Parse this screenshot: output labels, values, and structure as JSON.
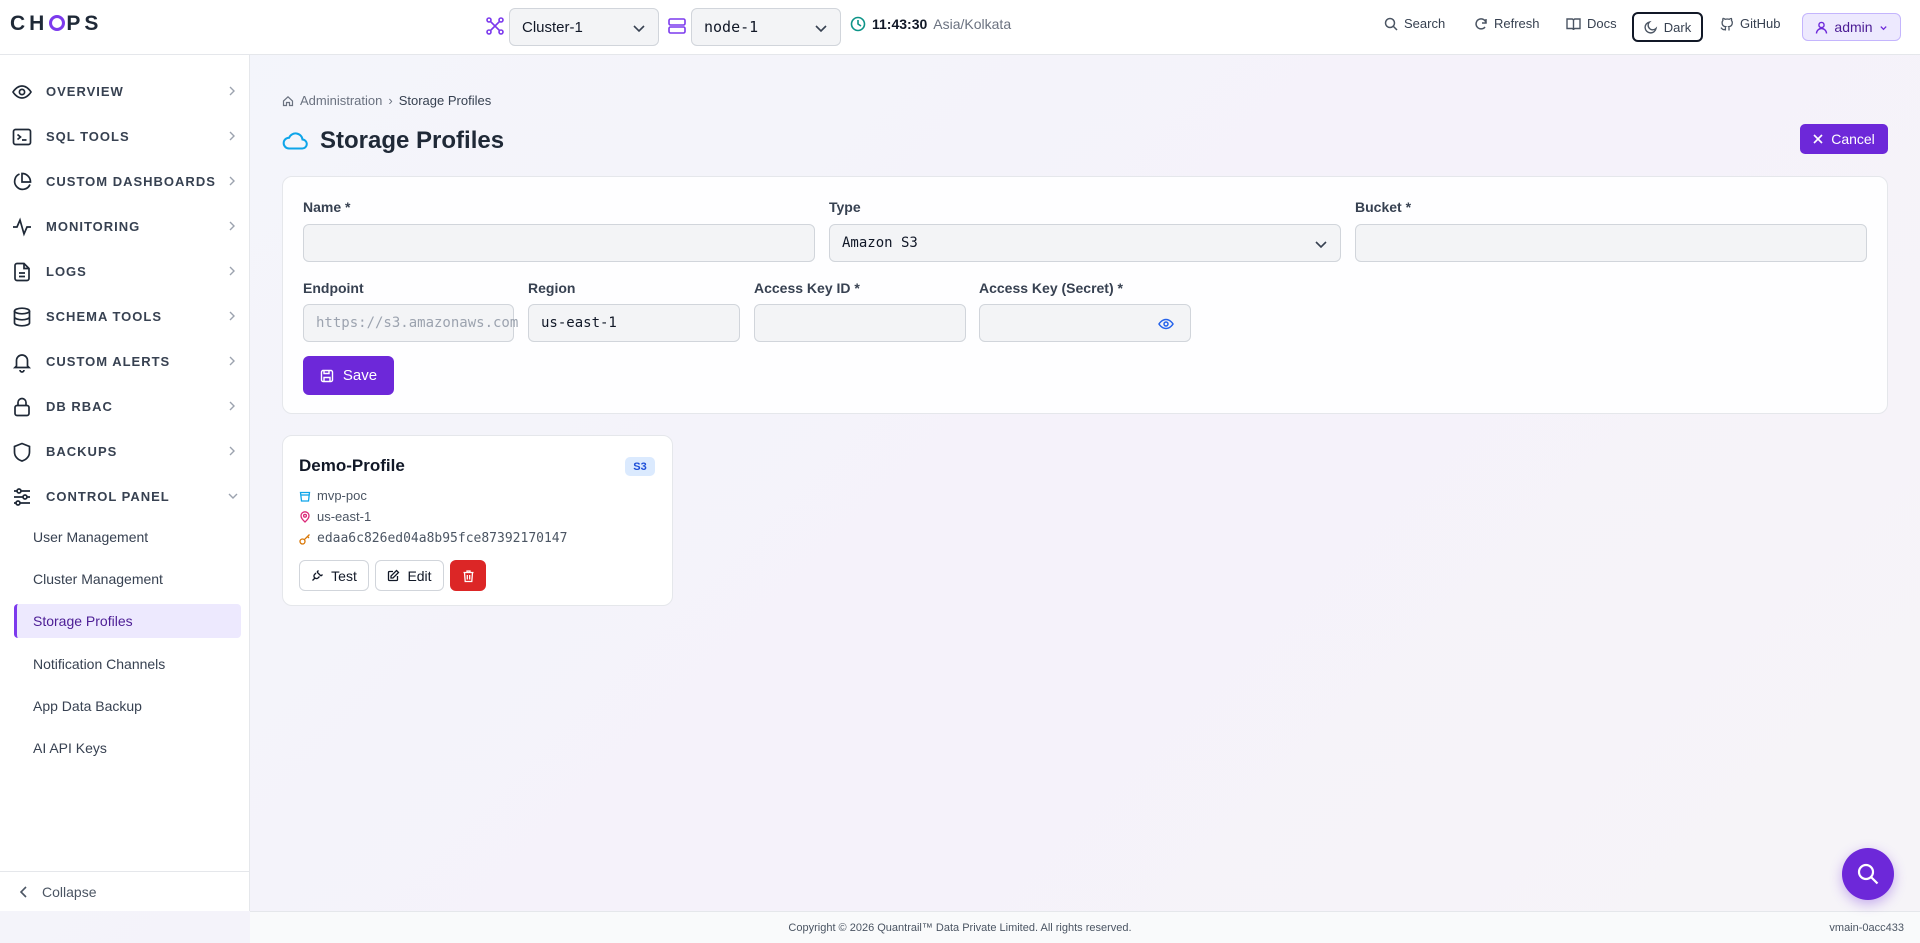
{
  "header": {
    "logo": "CHOPS",
    "cluster_select": "Cluster-1",
    "node_select": "node-1",
    "time": "11:43:30",
    "timezone": "Asia/Kolkata",
    "search_label": "Search",
    "refresh_label": "Refresh",
    "docs_label": "Docs",
    "theme_label": "Dark",
    "github_label": "GitHub",
    "user_label": "admin"
  },
  "sidebar": {
    "items": [
      {
        "label": "OVERVIEW",
        "icon": "eye-icon"
      },
      {
        "label": "SQL TOOLS",
        "icon": "terminal-icon"
      },
      {
        "label": "CUSTOM DASHBOARDS",
        "icon": "pie-chart-icon"
      },
      {
        "label": "MONITORING",
        "icon": "activity-icon"
      },
      {
        "label": "LOGS",
        "icon": "file-text-icon"
      },
      {
        "label": "SCHEMA TOOLS",
        "icon": "database-icon"
      },
      {
        "label": "CUSTOM ALERTS",
        "icon": "bell-icon"
      },
      {
        "label": "DB RBAC",
        "icon": "lock-icon"
      },
      {
        "label": "BACKUPS",
        "icon": "shield-icon"
      },
      {
        "label": "CONTROL PANEL",
        "icon": "sliders-icon"
      }
    ],
    "sub_items": [
      {
        "label": "User Management"
      },
      {
        "label": "Cluster Management"
      },
      {
        "label": "Storage Profiles"
      },
      {
        "label": "Notification Channels"
      },
      {
        "label": "App Data Backup"
      },
      {
        "label": "AI API Keys"
      }
    ],
    "active_sub_item": "Storage Profiles",
    "collapse_label": "Collapse"
  },
  "main": {
    "breadcrumb": {
      "parent": "Administration",
      "current": "Storage Profiles"
    },
    "title": "Storage Profiles",
    "cancel_label": "Cancel",
    "form": {
      "name_label": "Name *",
      "name_value": "",
      "type_label": "Type",
      "type_value": "Amazon S3",
      "bucket_label": "Bucket *",
      "bucket_value": "",
      "endpoint_label": "Endpoint",
      "endpoint_placeholder": "https://s3.amazonaws.com",
      "region_label": "Region",
      "region_value": "us-east-1",
      "access_key_label": "Access Key ID *",
      "access_key_value": "",
      "secret_label": "Access Key (Secret) *",
      "secret_value": "",
      "save_label": "Save"
    },
    "profile": {
      "name": "Demo-Profile",
      "badge": "S3",
      "bucket": "mvp-poc",
      "region": "us-east-1",
      "key_id": "edaa6c826ed04a8b95fce87392170147",
      "test_label": "Test",
      "edit_label": "Edit"
    }
  },
  "footer": {
    "copyright": "Copyright © 2026 Quantrail™ Data Private Limited. All rights reserved.",
    "version": "vmain-0acc433"
  },
  "colors": {
    "accent": "#6d28d9",
    "danger": "#dc2626",
    "active_bg": "#ede9fe"
  }
}
